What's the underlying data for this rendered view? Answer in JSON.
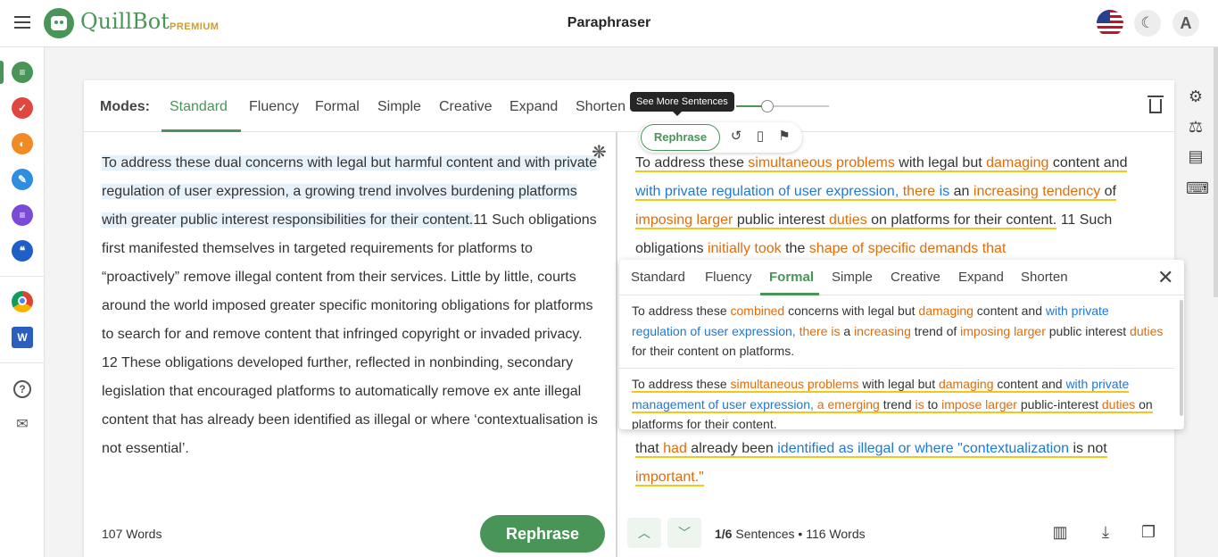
{
  "app": {
    "name": "QuillBot",
    "badge": "PREMIUM",
    "page_title": "Paraphraser",
    "avatar_letter": "A"
  },
  "modes": {
    "label": "Modes:",
    "tabs": [
      "Standard",
      "Fluency",
      "Formal",
      "Simple",
      "Creative",
      "Expand",
      "Shorten"
    ],
    "active": "Standard",
    "tooltip": "See More Sentences"
  },
  "input": {
    "highlighted_sentence": "To address these dual concerns with legal but harmful content and with private regulation of user expression, a growing trend involves burdening platforms with greater public interest responsibilities for their content.",
    "rest_text": "11 Such obligations first manifested themselves in targeted requirements for platforms to “proactively” remove illegal content from their services. Little by little, courts around the world imposed greater specific monitoring obligations for platforms to search for and remove content that infringed copyright or invaded privacy. 12 These obligations developed further, reflected in nonbinding, secondary legislation that encouraged platforms to automatically remove ex ante illegal content that has already been identified as illegal or where ‘contextualisation is not essential’.",
    "word_count": "107 Words",
    "rephrase_label": "Rephrase"
  },
  "output": {
    "segments": [
      {
        "t": "To address these ",
        "c": ""
      },
      {
        "t": "simultaneous problems",
        "c": "o-orange"
      },
      {
        "t": " with legal but ",
        "c": ""
      },
      {
        "t": "damaging",
        "c": "o-orange"
      },
      {
        "t": " content and ",
        "c": ""
      },
      {
        "t": "with private regulation of user expression,",
        "c": "o-blue"
      },
      {
        "t": " ",
        "c": ""
      },
      {
        "t": "there",
        "c": "o-orange"
      },
      {
        "t": " ",
        "c": ""
      },
      {
        "t": "is",
        "c": "o-blue"
      },
      {
        "t": " an ",
        "c": ""
      },
      {
        "t": "increasing tendency",
        "c": "o-orange"
      },
      {
        "t": " of ",
        "c": ""
      },
      {
        "t": "imposing larger",
        "c": "o-orange"
      },
      {
        "t": " public interest ",
        "c": ""
      },
      {
        "t": "duties",
        "c": "o-orange"
      },
      {
        "t": " on platforms for their content.",
        "c": ""
      },
      {
        "t": " 11 Such obligations ",
        "c": "plain"
      },
      {
        "t": "initially took",
        "c": "o-orange plain"
      },
      {
        "t": " the ",
        "c": "plain"
      },
      {
        "t": "shape of specific demands that",
        "c": "o-orange plain"
      }
    ],
    "tail_segments": [
      {
        "t": "that ",
        "c": ""
      },
      {
        "t": "had",
        "c": "o-orange"
      },
      {
        "t": " already been ",
        "c": ""
      },
      {
        "t": "identified as illegal or where \"contextualization",
        "c": "o-blue"
      },
      {
        "t": " is not ",
        "c": ""
      },
      {
        "t": "important.\"",
        "c": "o-orange"
      }
    ],
    "rephrase_pill_label": "Rephrase",
    "sentence_position": "1/6",
    "sentence_label": "Sentences",
    "word_count": "116 Words"
  },
  "popup": {
    "tabs": [
      "Standard",
      "Fluency",
      "Formal",
      "Simple",
      "Creative",
      "Expand",
      "Shorten"
    ],
    "active": "Formal",
    "alternatives": [
      [
        {
          "t": "To address these ",
          "c": ""
        },
        {
          "t": "combined",
          "c": "o-orange"
        },
        {
          "t": " concerns with legal but ",
          "c": ""
        },
        {
          "t": "damaging",
          "c": "o-orange"
        },
        {
          "t": " content and ",
          "c": ""
        },
        {
          "t": "with private regulation of user expression,",
          "c": "o-blue"
        },
        {
          "t": " ",
          "c": ""
        },
        {
          "t": "there is",
          "c": "o-orange"
        },
        {
          "t": " a ",
          "c": ""
        },
        {
          "t": "increasing",
          "c": "o-orange"
        },
        {
          "t": " trend of ",
          "c": ""
        },
        {
          "t": "imposing larger",
          "c": "o-orange"
        },
        {
          "t": " public interest ",
          "c": ""
        },
        {
          "t": "duties",
          "c": "o-orange"
        },
        {
          "t": " for their content on platforms.",
          "c": ""
        }
      ],
      [
        {
          "t": "To address these ",
          "c": ""
        },
        {
          "t": "simultaneous problems",
          "c": "o-orange"
        },
        {
          "t": " with legal but ",
          "c": ""
        },
        {
          "t": "damaging",
          "c": "o-orange"
        },
        {
          "t": " content and ",
          "c": ""
        },
        {
          "t": "with private management of user expression,",
          "c": "o-blue"
        },
        {
          "t": " ",
          "c": ""
        },
        {
          "t": "a emerging",
          "c": "o-orange"
        },
        {
          "t": " trend ",
          "c": ""
        },
        {
          "t": "is",
          "c": "o-orange"
        },
        {
          "t": " to ",
          "c": ""
        },
        {
          "t": "impose larger",
          "c": "o-orange"
        },
        {
          "t": " public-interest ",
          "c": ""
        },
        {
          "t": "duties",
          "c": "o-orange"
        },
        {
          "t": " on platforms for their content.",
          "c": ""
        }
      ]
    ]
  },
  "colors": {
    "brand_green": "#499557",
    "premium_gold": "#d39c25",
    "change_orange": "#e06d0a",
    "structure_blue": "#1e78d6",
    "highlight_bg": "#e6f1fa"
  }
}
